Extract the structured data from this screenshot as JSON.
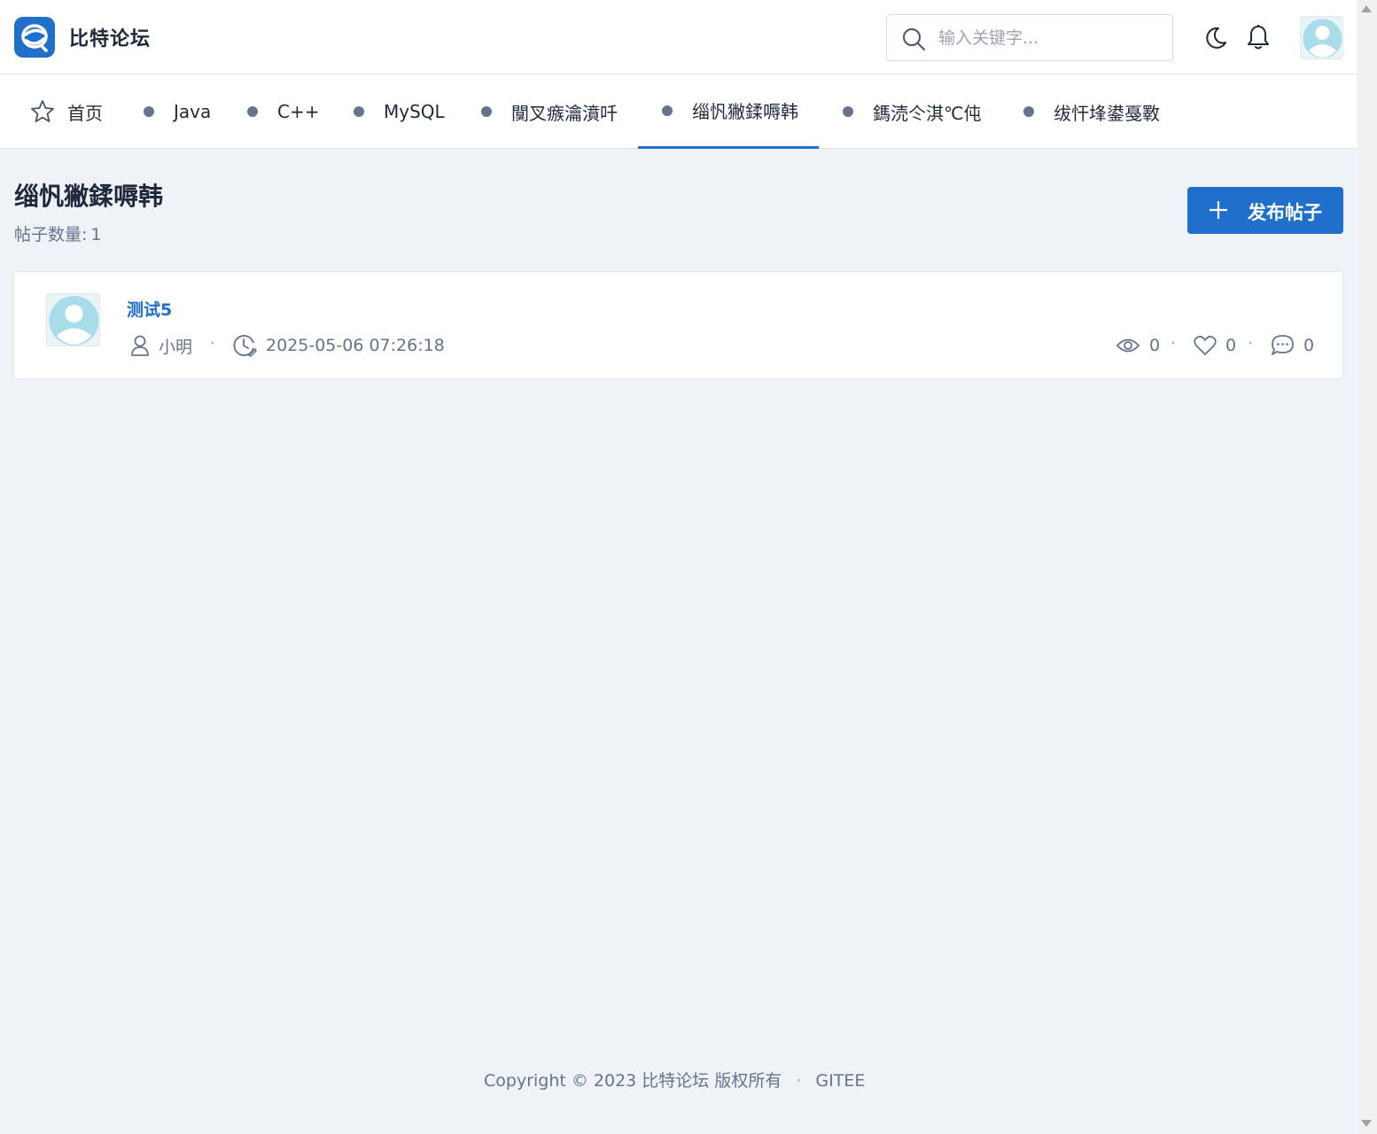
{
  "header": {
    "brand": "比特论坛",
    "search_placeholder": "输入关键字..."
  },
  "nav": {
    "tabs": [
      {
        "label": "首页",
        "icon": "star-icon"
      },
      {
        "label": "Java",
        "icon": "dot"
      },
      {
        "label": "C++",
        "icon": "dot"
      },
      {
        "label": "MySQL",
        "icon": "dot"
      },
      {
        "label": "闃叉瘯瀹濆吀",
        "icon": "dot"
      },
      {
        "label": "缁忛獙鍒嗕韩",
        "icon": "dot",
        "active": true
      },
      {
        "label": "鎷涜仒淇℃伅",
        "icon": "dot"
      },
      {
        "label": "绂忓埄鍙戞斁",
        "icon": "dot"
      }
    ]
  },
  "board": {
    "title": "缁忛獙鍒嗕韩",
    "post_count_label": "帖子数量:",
    "post_count": "1",
    "publish_label": "发布帖子"
  },
  "posts": [
    {
      "title": "测试5",
      "author": "小明",
      "time": "2025-05-06 07:26:18",
      "views": "0",
      "likes": "0",
      "comments": "0"
    }
  ],
  "footer": {
    "copyright": "Copyright © 2023 比特论坛 版权所有",
    "separator": "·",
    "link": "GITEE"
  },
  "meta_separator": "·",
  "colors": {
    "primary": "#1f6fcb",
    "background": "#eff3f8",
    "text": "#1e293b",
    "muted": "#64748b"
  }
}
